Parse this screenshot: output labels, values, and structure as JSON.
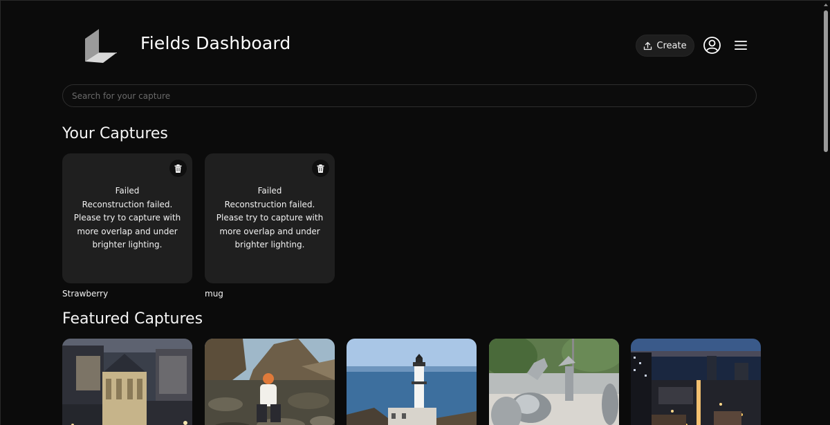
{
  "header": {
    "title": "Fields Dashboard",
    "create_label": "Create"
  },
  "search": {
    "placeholder": "Search for your capture"
  },
  "your_captures": {
    "heading": "Your Captures",
    "items": [
      {
        "name": "Strawberry",
        "status": "Failed",
        "message_lines": [
          "Reconstruction failed.",
          "Please try to capture with",
          "more overlap and under",
          "brighter lighting."
        ]
      },
      {
        "name": "mug",
        "status": "Failed",
        "message_lines": [
          "Reconstruction failed.",
          "Please try to capture with",
          "more overlap and under",
          "brighter lighting."
        ]
      }
    ]
  },
  "featured_captures": {
    "heading": "Featured Captures"
  },
  "icons": {
    "logo": "fields-logo-icon",
    "create": "upload-icon",
    "profile": "user-circle-icon",
    "menu": "hamburger-menu-icon",
    "delete": "trash-icon"
  },
  "colors": {
    "background": "#0b0b0b",
    "card": "#1f1f1f",
    "text": "#ffffff"
  }
}
